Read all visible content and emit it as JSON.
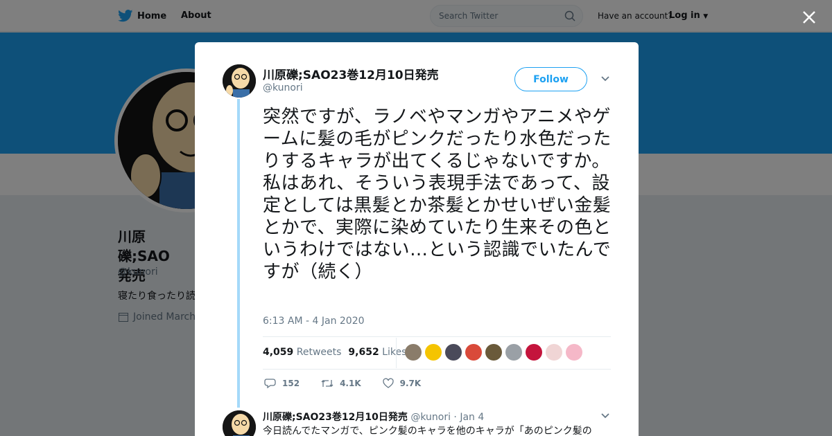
{
  "nav": {
    "home_label": "Home",
    "about_label": "About",
    "have_account": "Have an account?",
    "login_label": "Log in"
  },
  "search": {
    "placeholder": "Search Twitter"
  },
  "profile": {
    "name": "川原礫;SAO23巻12月10日発売",
    "name_partial": "川原礫;SAO",
    "name_partial2": "発売",
    "handle": "@kunori",
    "bio_partial": "寝たり食ったり読",
    "joined_partial": "Joined March"
  },
  "tweet": {
    "author_name": "川原礫;SAO23巻12月10日発売",
    "author_handle": "@kunori",
    "follow_label": "Follow",
    "text": "突然ですが、ラノベやマンガやアニメやゲームに髪の毛がピンクだったり水色だったりするキャラが出てくるじゃないですか。私はあれ、そういう表現手法であって、設定としては黒髪とか茶髪とかせいぜい金髪とかで、実際に染めていたり生来その色というわけではない…という認識でいたんですが（続く）",
    "timestamp": "6:13 AM - 4 Jan 2020",
    "retweets_count": "4,059",
    "retweets_label": "Retweets",
    "likes_count": "9,652",
    "likes_label": "Likes",
    "reply_count": "152",
    "retweet_count_short": "4.1K",
    "like_count_short": "9.7K"
  },
  "likers": [
    "#8a7c6a",
    "#f5c400",
    "#4a4a5a",
    "#d94a3a",
    "#6a5a3a",
    "#9aa0a6",
    "#c4143c",
    "#f0d5d5",
    "#f5b8c8"
  ],
  "reply": {
    "author_name": "川原礫;SAO23巻12月10日発売",
    "author_handle": "@kunori",
    "date": "Jan 4",
    "separator": "·",
    "text": "今日読んでたマンガで、ピンク髪のキャラを他のキャラが「あのピンク髪の"
  },
  "colors": {
    "brand": "#1da1f2",
    "thread": "#a4d9f9"
  }
}
